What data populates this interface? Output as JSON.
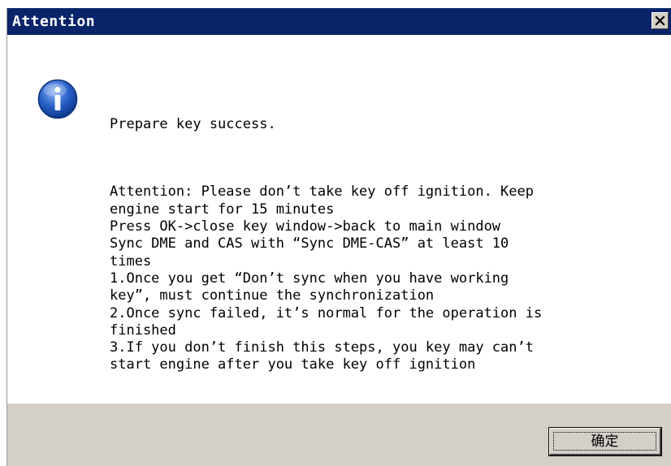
{
  "dialog": {
    "title": "Attention",
    "close_glyph": "×",
    "icon": "info-icon",
    "message_first": "Prepare key success.",
    "message_body": "Attention: Please don’t take key off ignition. Keep\nengine start for 15 minutes\nPress OK->close key window->back to main window\nSync DME and CAS with “Sync DME-CAS” at least 10\ntimes\n1.Once you get “Don’t sync when you have working\nkey”, must continue the synchronization\n2.Once sync failed, it’s normal for the operation is\nfinished\n3.If you don’t finish this steps, you key may can’t\nstart engine after you take key off ignition",
    "ok_label": "确定"
  },
  "colors": {
    "titlebar": "#0a246a",
    "face": "#d4d0c8",
    "icon_blue": "#2a62c9"
  }
}
